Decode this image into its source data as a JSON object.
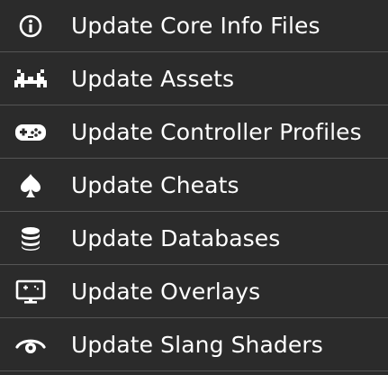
{
  "menu": {
    "items": [
      {
        "label": "Update Core Info Files",
        "icon": "info-icon"
      },
      {
        "label": "Update Assets",
        "icon": "space-invader-icon"
      },
      {
        "label": "Update Controller Profiles",
        "icon": "gamepad-icon"
      },
      {
        "label": "Update Cheats",
        "icon": "spade-icon"
      },
      {
        "label": "Update Databases",
        "icon": "database-icon"
      },
      {
        "label": "Update Overlays",
        "icon": "monitor-icon"
      },
      {
        "label": "Update Slang Shaders",
        "icon": "eye-icon"
      }
    ]
  },
  "colors": {
    "background": "#2b2b2b",
    "text": "#ffffff",
    "divider": "#555555"
  }
}
